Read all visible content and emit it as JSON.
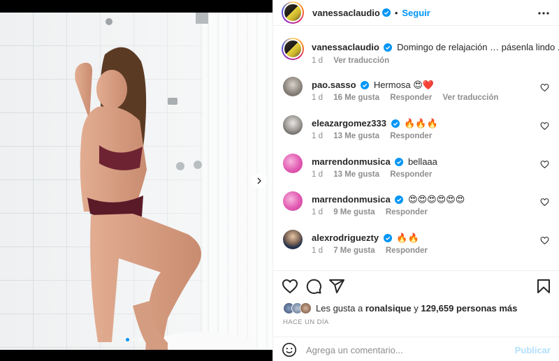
{
  "post": {
    "username": "vanessaclaudio",
    "follow_label": "Seguir",
    "separator": "•",
    "caption": "Domingo de relajación … pásenla lindo ..",
    "caption_age": "1 d",
    "caption_translate": "Ver traducción"
  },
  "comments": [
    {
      "username": "pao.sasso",
      "text": "Hermosa 😍❤️",
      "age": "1 d",
      "likes": "16 Me gusta",
      "reply": "Responder",
      "translate": "Ver traducción",
      "avatar": "av-pao"
    },
    {
      "username": "eleazargomez333",
      "text": "🔥🔥🔥",
      "age": "1 d",
      "likes": "13 Me gusta",
      "reply": "Responder",
      "translate": "",
      "avatar": "av-eleazar"
    },
    {
      "username": "marrendonmusica",
      "text": "bellaaa",
      "age": "1 d",
      "likes": "13 Me gusta",
      "reply": "Responder",
      "translate": "",
      "avatar": "av-marrendon"
    },
    {
      "username": "marrendonmusica",
      "text": "😍😍😍😍😍😍",
      "age": "1 d",
      "likes": "9 Me gusta",
      "reply": "Responder",
      "translate": "",
      "avatar": "av-marrendon"
    },
    {
      "username": "alexrodriguezty",
      "text": "🔥🔥",
      "age": "1 d",
      "likes": "7 Me gusta",
      "reply": "Responder",
      "translate": "",
      "avatar": "av-alex"
    }
  ],
  "likes": {
    "prefix": "Les gusta a",
    "user": "ronalsique",
    "conj": "y",
    "others": "129,659 personas más"
  },
  "time_ago": "HACE UN DÍA",
  "composer": {
    "placeholder": "Agrega un comentario...",
    "publish_label": "Publicar"
  },
  "carousel": {
    "slides": 3,
    "active_slide": 1
  },
  "colors": {
    "accent": "#0095f6",
    "publish_disabled": "#b2dffc",
    "muted": "#8e8e8e"
  },
  "icons": [
    "verified-badge-icon",
    "more-options-icon",
    "heart-icon",
    "comment-icon",
    "share-icon",
    "bookmark-icon",
    "emoji-icon",
    "chevron-right-icon"
  ]
}
